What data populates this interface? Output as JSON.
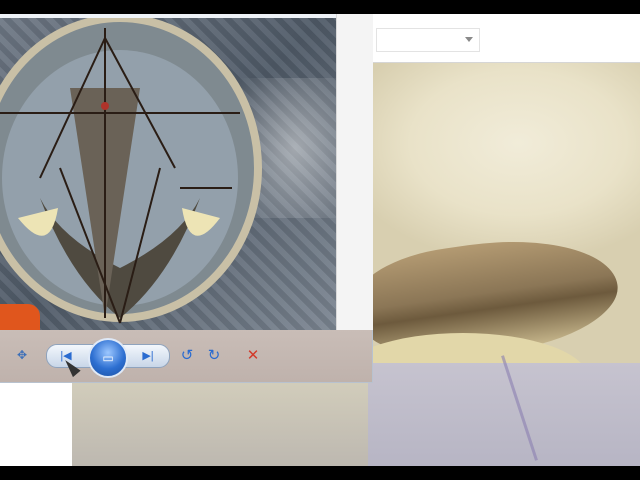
{
  "back_window": {
    "dropdown_value": ""
  },
  "viewer": {
    "controls": {
      "pan_icon": "pan-icon",
      "prev_icon": "previous-icon",
      "slideshow_icon": "slideshow-icon",
      "next_icon": "next-icon",
      "rotate_left_icon": "rotate-ccw-icon",
      "rotate_right_icon": "rotate-cw-icon",
      "delete_icon": "delete-icon"
    },
    "glyphs": {
      "pan": "✥",
      "prev": "|◀",
      "slideshow": "▭",
      "next": "▶|",
      "rotate_left": "↺",
      "rotate_right": "↻",
      "delete": "✕"
    }
  },
  "colors": {
    "accent": "#2d6fd1",
    "delete": "#d23b2b",
    "controls_bar": "#c4b8b2"
  }
}
